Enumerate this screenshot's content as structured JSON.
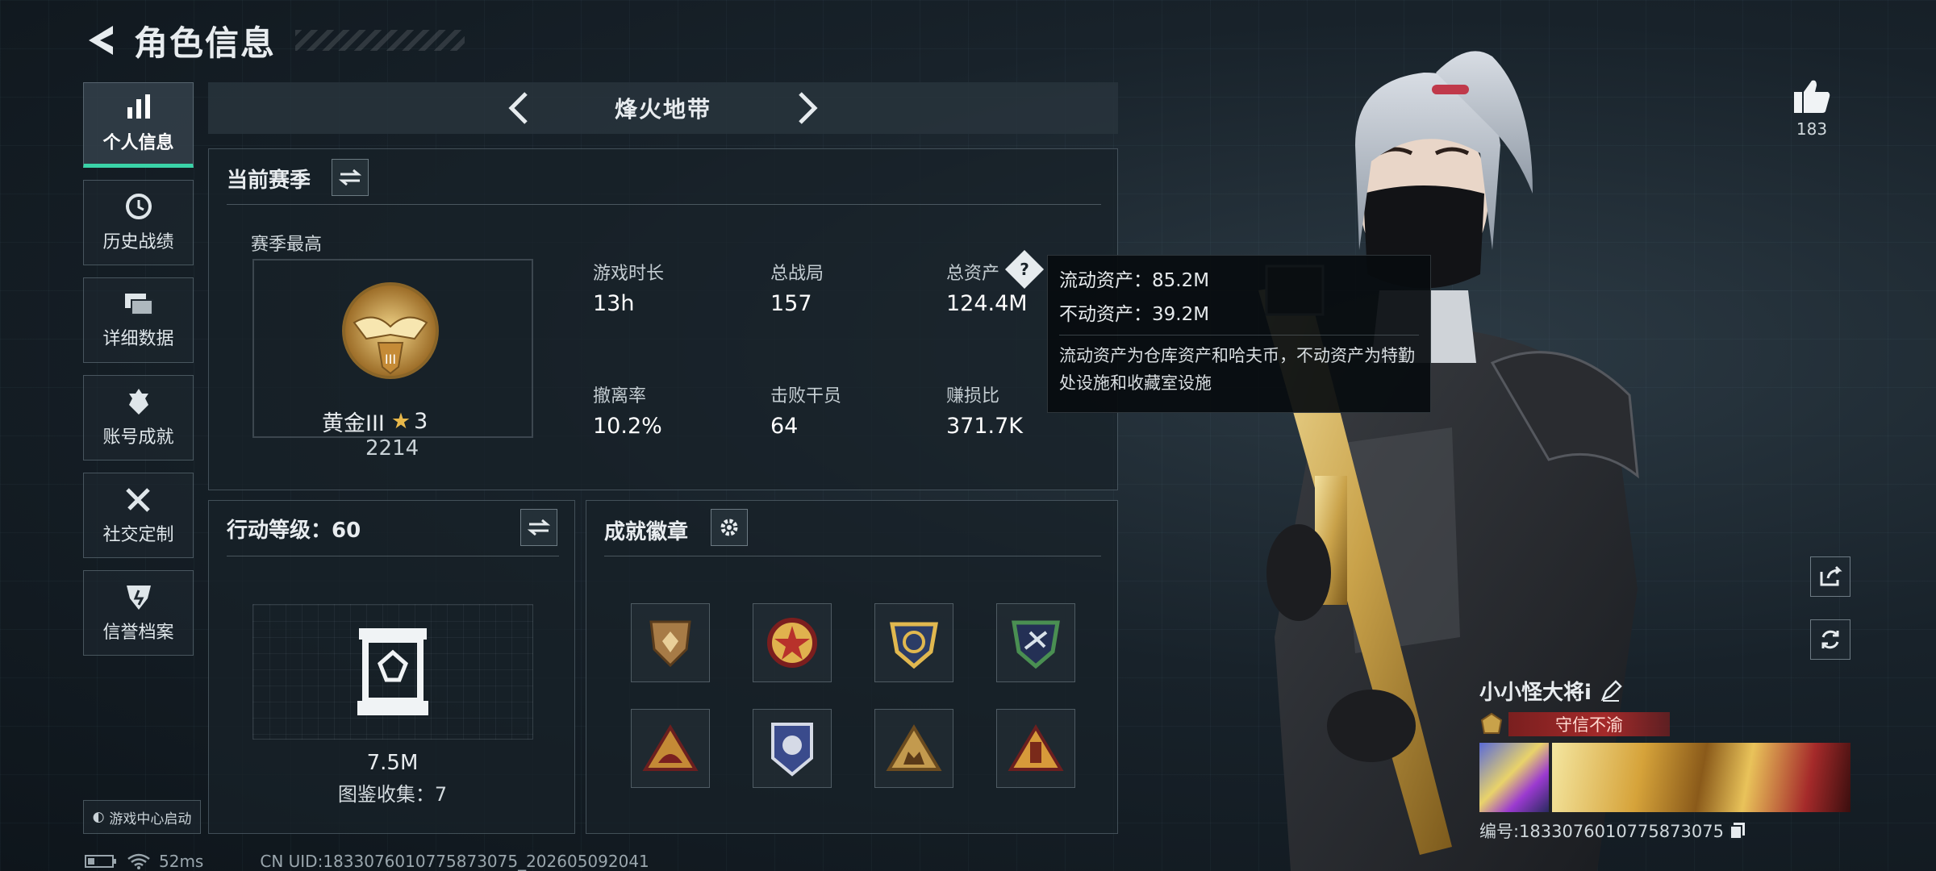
{
  "header": {
    "title": "角色信息"
  },
  "sidebar": {
    "items": [
      {
        "label": "个人信息",
        "icon": "bar-chart-icon",
        "active": true
      },
      {
        "label": "历史战绩",
        "icon": "history-icon"
      },
      {
        "label": "详细数据",
        "icon": "stack-icon"
      },
      {
        "label": "账号成就",
        "icon": "achievement-icon"
      },
      {
        "label": "社交定制",
        "icon": "tools-icon"
      },
      {
        "label": "信誉档案",
        "icon": "shield-icon"
      }
    ],
    "launch_label": "游戏中心启动"
  },
  "mode_bar": {
    "name": "烽火地带"
  },
  "season": {
    "title": "当前赛季",
    "best_label": "赛季最高",
    "rank_name": "黄金III",
    "rank_stars": "3",
    "rank_points": "2214",
    "stats": [
      {
        "label": "游戏时长",
        "value": "13h"
      },
      {
        "label": "总战局",
        "value": "157"
      },
      {
        "label": "总资产",
        "value": "124.4M"
      },
      {
        "label": "撤离率",
        "value": "10.2%"
      },
      {
        "label": "击败干员",
        "value": "64"
      },
      {
        "label": "赚损比",
        "value": "371.7K"
      }
    ]
  },
  "action_level": {
    "title": "行动等级：60",
    "value": "7.5M",
    "collection": "图鉴收集：7"
  },
  "badges": {
    "title": "成就徽章"
  },
  "tooltip": {
    "liquid": "流动资产：85.2M",
    "fixed": "不动资产：39.2M",
    "desc": "流动资产为仓库资产和哈夫币，不动资产为特勤处设施和收藏室设施"
  },
  "likes": {
    "count": "183"
  },
  "player": {
    "name": "小小怪大将i",
    "title_tag": "守信不渝",
    "id_text": "编号:1833076010775873075"
  },
  "status_bar": {
    "ping": "52ms",
    "uid": "CN UID:1833076010775873075_202605092041"
  },
  "colors": {
    "accent": "#3ad3a8",
    "tag_red": "#a42a2a",
    "gold": "#c9a24a"
  }
}
